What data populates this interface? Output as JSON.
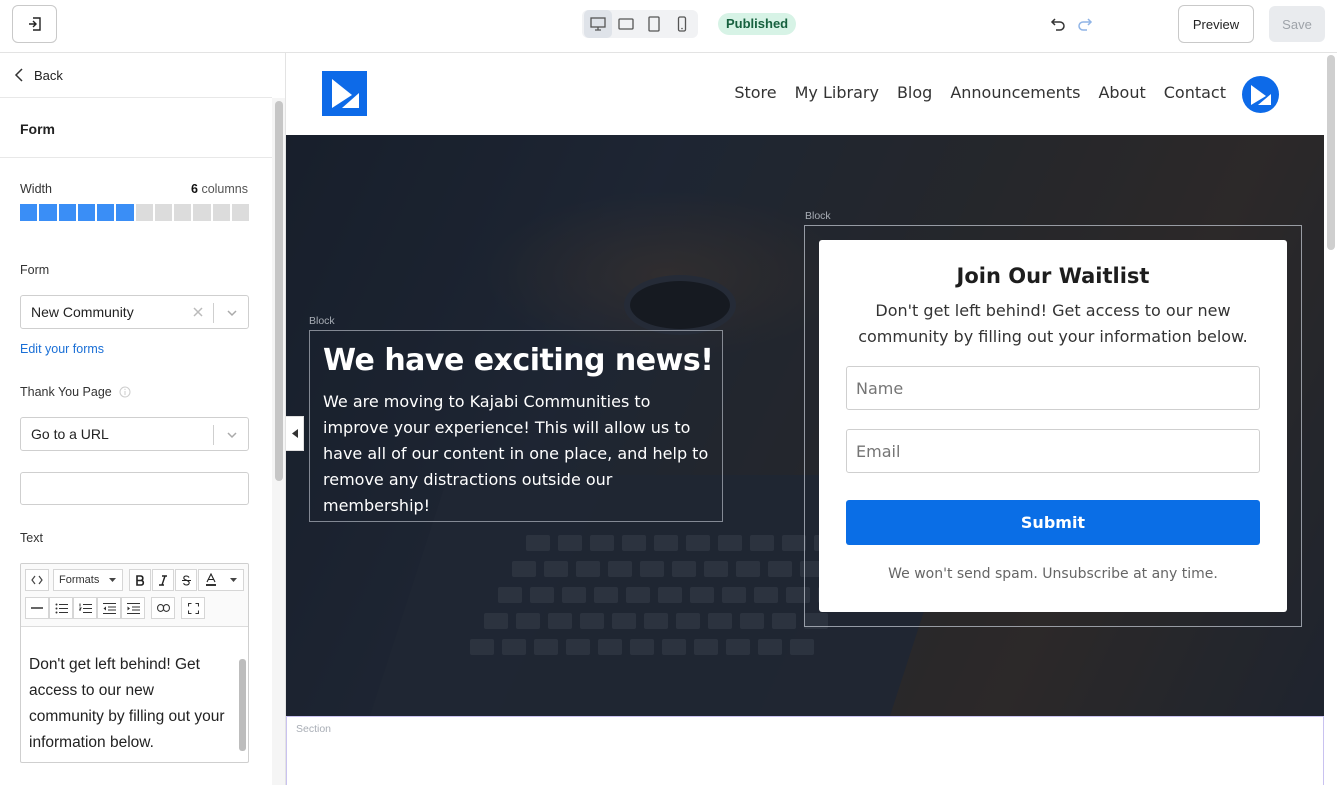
{
  "topbar": {
    "status": "Published",
    "preview_label": "Preview",
    "save_label": "Save"
  },
  "sidebar": {
    "back_label": "Back",
    "section_title": "Form",
    "width_label": "Width",
    "width_value": "6",
    "width_unit": "columns",
    "width_selected": 6,
    "width_total": 12,
    "form_label": "Form",
    "form_value": "New Community",
    "edit_forms_link": "Edit your forms",
    "thank_you_label": "Thank You Page",
    "thank_you_value": "Go to a URL",
    "url_value": "",
    "text_label": "Text",
    "rte": {
      "formats_label": "Formats",
      "body": "Don't get left behind! Get access to our new community by filling out your information below."
    }
  },
  "site": {
    "nav": [
      "Store",
      "My Library",
      "Blog",
      "Announcements",
      "About",
      "Contact"
    ],
    "block_label": "Block",
    "section_label": "Section",
    "headline": "We have exciting news!",
    "subtext": "We are moving to Kajabi Communities to improve your experience! This will allow us to have all of our content in one place, and help to remove any distractions outside our membership!",
    "form": {
      "title": "Join Our Waitlist",
      "description": "Don't get left behind! Get access to our new community by filling out your information below.",
      "name_placeholder": "Name",
      "email_placeholder": "Email",
      "submit_label": "Submit",
      "spam_note": "We won't send spam. Unsubscribe at any time."
    }
  },
  "colors": {
    "accent": "#0a6ee6",
    "column_on": "#3a8ef6",
    "published_bg": "#d7f3e6"
  }
}
